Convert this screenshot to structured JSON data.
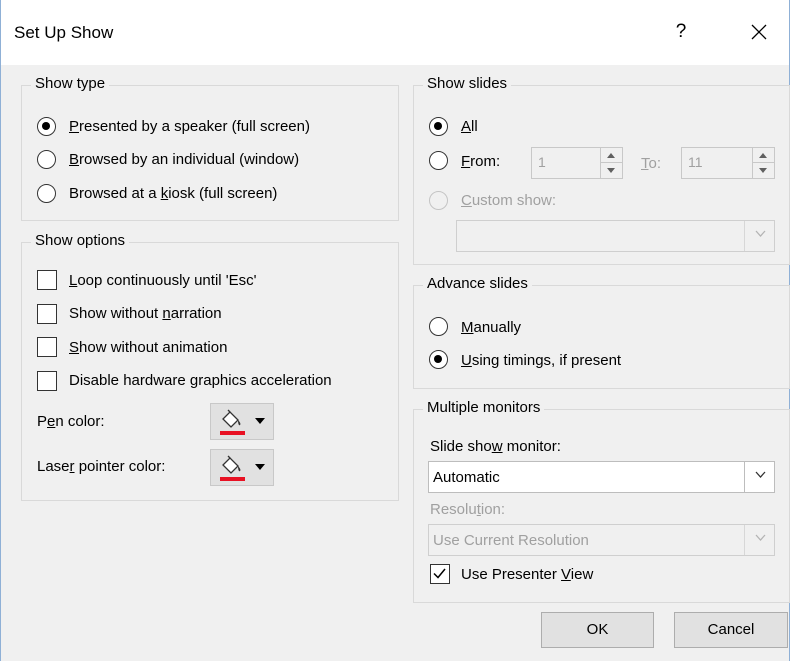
{
  "dialog": {
    "title": "Set Up Show",
    "help": "?"
  },
  "show_type": {
    "legend": "Show type",
    "options": [
      {
        "pre": "",
        "u": "P",
        "post": "resented by a speaker (full screen)",
        "checked": true
      },
      {
        "pre": "",
        "u": "B",
        "post": "rowsed by an individual (window)",
        "checked": false
      },
      {
        "pre": "Browsed at a ",
        "u": "k",
        "post": "iosk (full screen)",
        "checked": false
      }
    ]
  },
  "show_options": {
    "legend": "Show options",
    "checks": [
      {
        "pre": "",
        "u": "L",
        "post": "oop continuously until 'Esc'",
        "checked": false
      },
      {
        "pre": "Show without ",
        "u": "n",
        "post": "arration",
        "checked": false
      },
      {
        "pre": "",
        "u": "S",
        "post": "how without animation",
        "checked": false
      },
      {
        "pre": "Disable hardware ",
        "u": "g",
        "post": "raphics acceleration",
        "checked": false
      }
    ],
    "pen_color": {
      "pre": "P",
      "u": "e",
      "post": "n color:",
      "color": "#e81123"
    },
    "laser_color": {
      "pre": "Lase",
      "u": "r",
      "post": " pointer color:",
      "color": "#e81123"
    }
  },
  "show_slides": {
    "legend": "Show slides",
    "all": {
      "u": "A",
      "post": "ll",
      "checked": true
    },
    "from": {
      "u": "F",
      "post": "rom:",
      "value": "1",
      "checked": false
    },
    "to": {
      "u": "T",
      "post": "o:",
      "value": "11"
    },
    "custom": {
      "u": "C",
      "post": "ustom show:",
      "value": ""
    }
  },
  "advance_slides": {
    "legend": "Advance slides",
    "manually": {
      "u": "M",
      "post": "anually",
      "checked": false
    },
    "timings": {
      "u": "U",
      "post": "sing timings, if present",
      "checked": true
    }
  },
  "multiple_monitors": {
    "legend": "Multiple monitors",
    "monitor_label": {
      "pre": "Slide sho",
      "u": "w",
      "post": " monitor:"
    },
    "monitor_value": "Automatic",
    "resolution_label": {
      "pre": "Resolu",
      "u": "t",
      "post": "ion:"
    },
    "resolution_value": "Use Current Resolution",
    "presenter": {
      "pre": "Use Presenter ",
      "u": "V",
      "post": "iew",
      "checked": true
    }
  },
  "buttons": {
    "ok": "OK",
    "cancel": "Cancel"
  },
  "icons": {
    "close": "close-icon",
    "paint_bucket": "paint-bucket-icon",
    "checkmark": "checkmark-icon"
  }
}
